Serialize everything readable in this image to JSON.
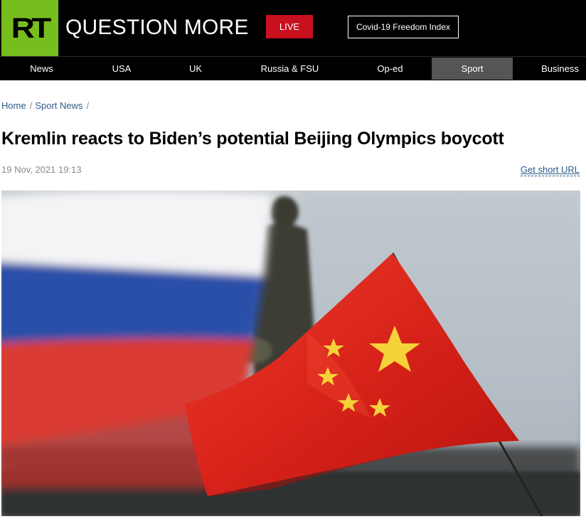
{
  "header": {
    "logo_text": "RT",
    "tagline": "QUESTION MORE",
    "live_label": "LIVE",
    "index_label": "Covid-19 Freedom Index"
  },
  "nav": {
    "items": [
      "News",
      "USA",
      "UK",
      "Russia & FSU",
      "Op-ed",
      "Sport",
      "Business"
    ],
    "active": "Sport"
  },
  "breadcrumb": {
    "home": "Home",
    "section": "Sport News",
    "separator": "/"
  },
  "article": {
    "title": "Kremlin reacts to Biden’s potential Beijing Olympics boycott",
    "date": "19 Nov, 2021 19:13",
    "short_url_label": "Get short URL"
  },
  "colors": {
    "brand_green": "#77bd1e",
    "live_red": "#c8101e",
    "active_nav": "#555555",
    "link_blue": "#2d5a8a"
  }
}
